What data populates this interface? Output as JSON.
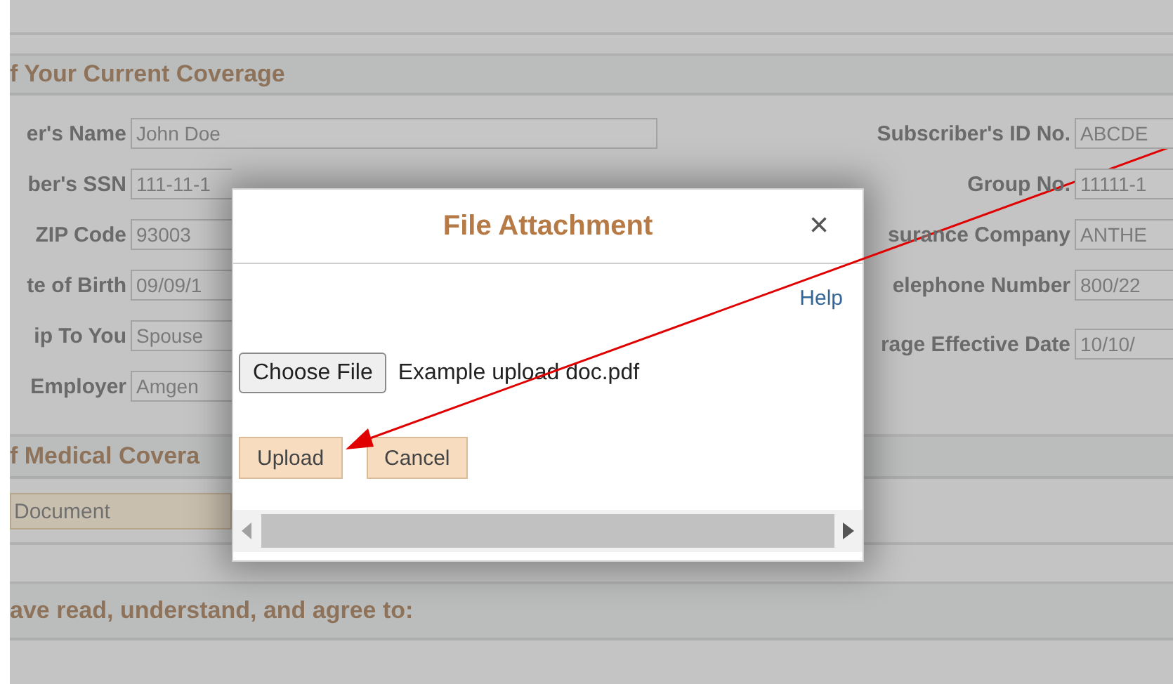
{
  "form": {
    "section_1_title": "f Your Current Coverage",
    "left_fields": [
      {
        "label": "er's Name",
        "value": "John Doe",
        "kind": "wide"
      },
      {
        "label": "ber's SSN",
        "value": "111-11-1",
        "kind": "cut"
      },
      {
        "label": "ZIP Code",
        "value": "93003",
        "kind": "cut"
      },
      {
        "label": "te of Birth",
        "value": "09/09/1",
        "kind": "cut"
      },
      {
        "label": "ip To You",
        "value": "Spouse",
        "kind": "cut"
      },
      {
        "label": "Employer",
        "value": "Amgen",
        "kind": "cut"
      }
    ],
    "right_fields": [
      {
        "label": "Subscriber's ID No.",
        "value": "ABCDE"
      },
      {
        "label": "Group No.",
        "value": "11111-1"
      },
      {
        "label": "surance Company",
        "value": "ANTHE"
      },
      {
        "label": "elephone Number",
        "value": "800/22"
      },
      {
        "label": "rage Effective Date",
        "value": "10/10/"
      }
    ],
    "section_2_title": "f Medical Covera",
    "document_button": "Document",
    "section_3_title": "ave read, understand, and agree to:"
  },
  "dialog": {
    "title": "File Attachment",
    "close": "×",
    "help_link": "Help",
    "choose_file_button": "Choose File",
    "file_name": "Example upload doc.pdf",
    "buttons": [
      "Upload",
      "Cancel"
    ]
  }
}
